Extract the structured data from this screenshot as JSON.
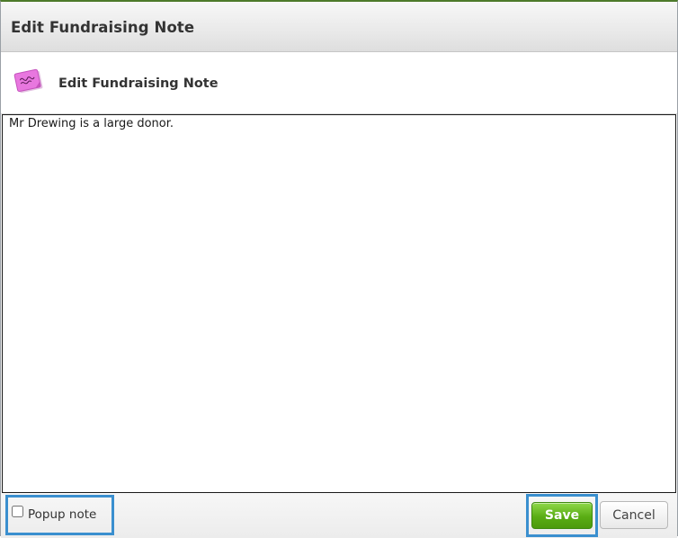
{
  "dialog": {
    "title": "Edit Fundraising Note",
    "header_text": "Edit Fundraising Note",
    "header_icon": "sticky-note-icon",
    "note_text": "Mr Drewing is a large donor.",
    "popup_note_label": "Popup note",
    "popup_note_checked": false,
    "save_label": "Save",
    "cancel_label": "Cancel"
  },
  "colors": {
    "save_button": "#5aad14",
    "highlight_border": "#3a8fcf",
    "top_border": "#4d7a2a",
    "note_icon": "#e06ad8"
  }
}
